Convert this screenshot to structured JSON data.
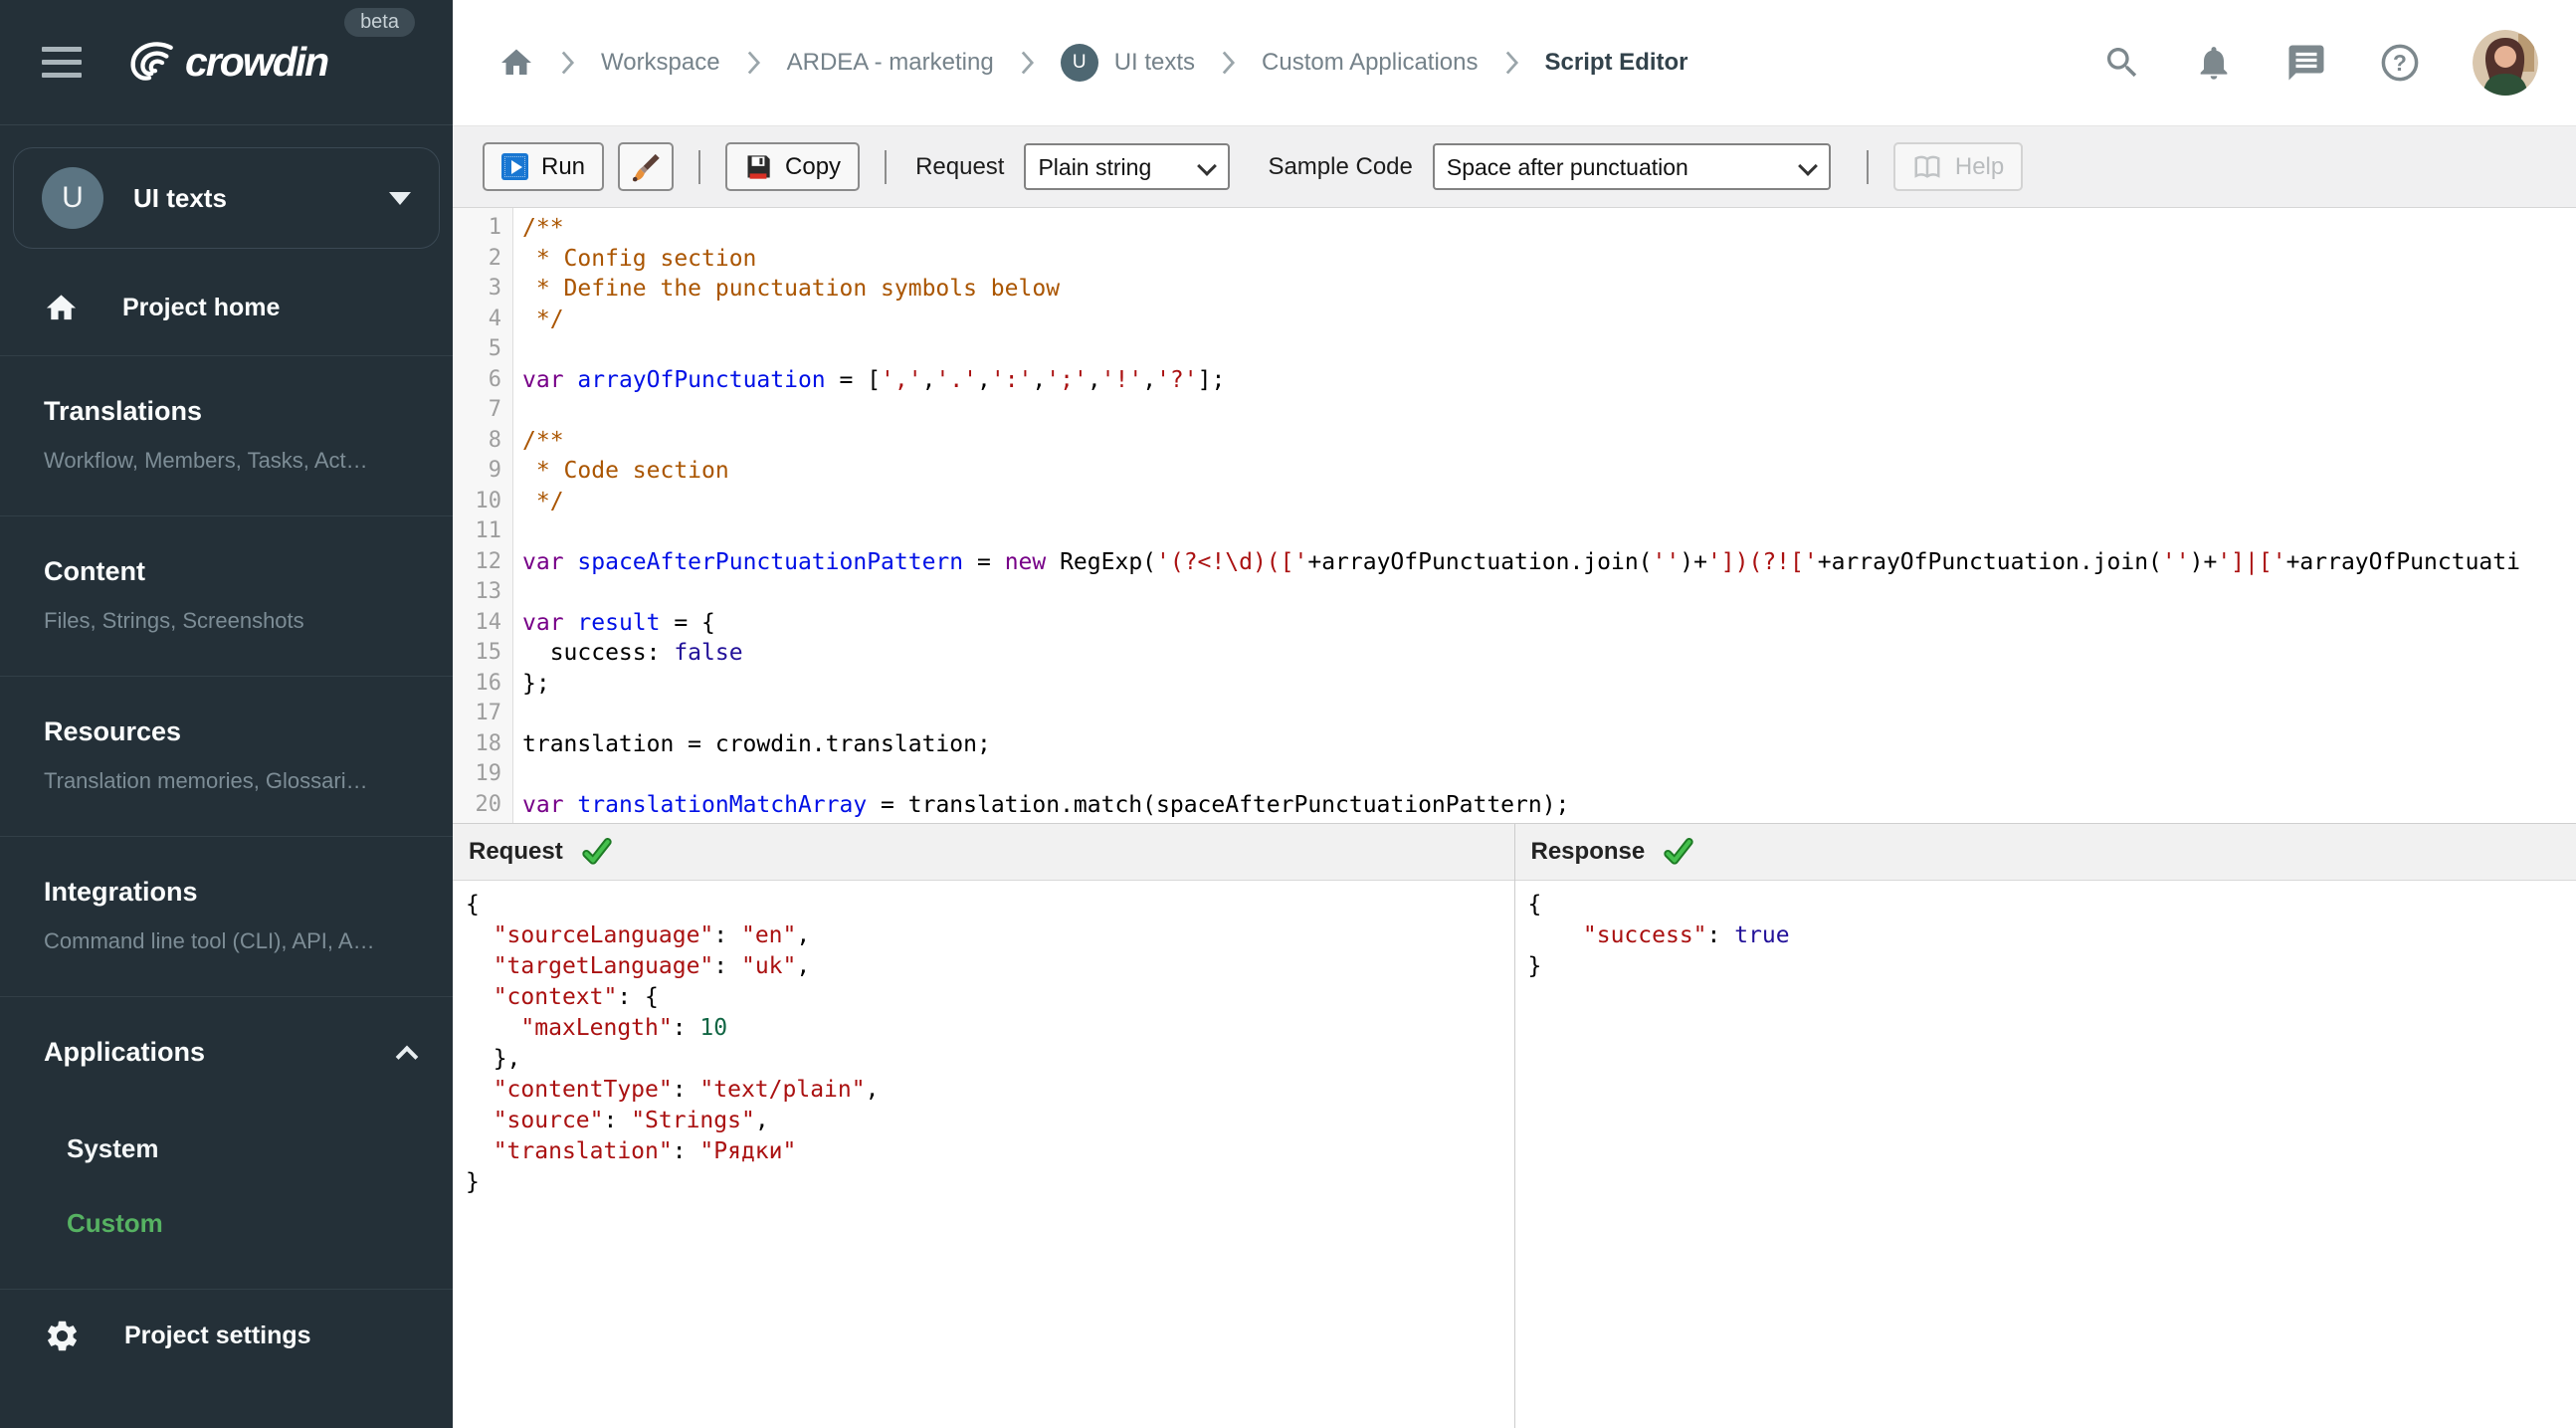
{
  "theme": {
    "sidebar_bg": "#243038",
    "accent_green": "#56b262",
    "run_icon_blue": "#1977d2",
    "check_green": "#2fa138",
    "syntax": {
      "comment": "#aa5500",
      "keyword": "#770088",
      "definition": "#0010e6",
      "string": "#aa1111",
      "number": "#116644",
      "atom": "#221199"
    }
  },
  "sidebar": {
    "logo_text": "crowdin",
    "beta_label": "beta",
    "project_selector": {
      "initial": "U",
      "name": "UI texts"
    },
    "project_home_label": "Project home",
    "sections": [
      {
        "title": "Translations",
        "subtitle": "Workflow, Members, Tasks, Act…"
      },
      {
        "title": "Content",
        "subtitle": "Files, Strings, Screenshots"
      },
      {
        "title": "Resources",
        "subtitle": "Translation memories, Glossari…"
      },
      {
        "title": "Integrations",
        "subtitle": "Command line tool (CLI), API, A…"
      }
    ],
    "applications": {
      "title": "Applications",
      "children": [
        {
          "label": "System",
          "active": false
        },
        {
          "label": "Custom",
          "active": true
        }
      ]
    },
    "project_settings_label": "Project settings"
  },
  "header": {
    "breadcrumbs": {
      "workspace": "Workspace",
      "organization": "ARDEA - marketing",
      "project": "UI texts",
      "project_initial": "U",
      "section": "Custom Applications",
      "current": "Script Editor"
    },
    "icons": [
      "search-icon",
      "bell-icon",
      "chat-icon",
      "help-icon",
      "user-avatar"
    ]
  },
  "toolbar": {
    "run_label": "Run",
    "copy_label": "Copy",
    "request_label": "Request",
    "request_value": "Plain string",
    "sample_code_label": "Sample Code",
    "sample_code_value": "Space after punctuation",
    "help_label": "Help",
    "icons": [
      "run-icon",
      "brush-icon",
      "save-icon",
      "book-icon"
    ]
  },
  "editor": {
    "language": "javascript",
    "lines": [
      [
        {
          "c": "c",
          "t": "/**"
        }
      ],
      [
        {
          "c": "c",
          "t": " * Config section"
        }
      ],
      [
        {
          "c": "c",
          "t": " * Define the punctuation symbols below"
        }
      ],
      [
        {
          "c": "c",
          "t": " */"
        }
      ],
      [],
      [
        {
          "c": "k",
          "t": "var"
        },
        {
          "c": "p",
          "t": " "
        },
        {
          "c": "d",
          "t": "arrayOfPunctuation"
        },
        {
          "c": "p",
          "t": " = ["
        },
        {
          "c": "s",
          "t": "','"
        },
        {
          "c": "p",
          "t": ","
        },
        {
          "c": "s",
          "t": "'.'"
        },
        {
          "c": "p",
          "t": ","
        },
        {
          "c": "s",
          "t": "':'"
        },
        {
          "c": "p",
          "t": ","
        },
        {
          "c": "s",
          "t": "';'"
        },
        {
          "c": "p",
          "t": ","
        },
        {
          "c": "s",
          "t": "'!'"
        },
        {
          "c": "p",
          "t": ","
        },
        {
          "c": "s",
          "t": "'?'"
        },
        {
          "c": "p",
          "t": "];"
        }
      ],
      [],
      [
        {
          "c": "c",
          "t": "/**"
        }
      ],
      [
        {
          "c": "c",
          "t": " * Code section"
        }
      ],
      [
        {
          "c": "c",
          "t": " */"
        }
      ],
      [],
      [
        {
          "c": "k",
          "t": "var"
        },
        {
          "c": "p",
          "t": " "
        },
        {
          "c": "d",
          "t": "spaceAfterPunctuationPattern"
        },
        {
          "c": "p",
          "t": " = "
        },
        {
          "c": "k",
          "t": "new"
        },
        {
          "c": "p",
          "t": " RegExp("
        },
        {
          "c": "s",
          "t": "'(?<!\\d)(['"
        },
        {
          "c": "p",
          "t": "+arrayOfPunctuation.join("
        },
        {
          "c": "s",
          "t": "''"
        },
        {
          "c": "p",
          "t": ")+"
        },
        {
          "c": "s",
          "t": "'])(?!['"
        },
        {
          "c": "p",
          "t": "+arrayOfPunctuation.join("
        },
        {
          "c": "s",
          "t": "''"
        },
        {
          "c": "p",
          "t": ")+"
        },
        {
          "c": "s",
          "t": "']|['"
        },
        {
          "c": "p",
          "t": "+arrayOfPunctuati"
        }
      ],
      [],
      [
        {
          "c": "k",
          "t": "var"
        },
        {
          "c": "p",
          "t": " "
        },
        {
          "c": "d",
          "t": "result"
        },
        {
          "c": "p",
          "t": " = {"
        }
      ],
      [
        {
          "c": "p",
          "t": "  success: "
        },
        {
          "c": "a",
          "t": "false"
        }
      ],
      [
        {
          "c": "p",
          "t": "};"
        }
      ],
      [],
      [
        {
          "c": "p",
          "t": "translation = crowdin.translation;"
        }
      ],
      [],
      [
        {
          "c": "k",
          "t": "var"
        },
        {
          "c": "p",
          "t": " "
        },
        {
          "c": "d",
          "t": "translationMatchArray"
        },
        {
          "c": "p",
          "t": " = translation.match(spaceAfterPunctuationPattern);"
        }
      ],
      []
    ]
  },
  "request_panel": {
    "title": "Request",
    "status_icon": "check-icon",
    "lines": [
      [
        {
          "c": "p",
          "t": "{"
        }
      ],
      [
        {
          "c": "p",
          "t": "  "
        },
        {
          "c": "s",
          "t": "\"sourceLanguage\""
        },
        {
          "c": "p",
          "t": ": "
        },
        {
          "c": "s",
          "t": "\"en\""
        },
        {
          "c": "p",
          "t": ","
        }
      ],
      [
        {
          "c": "p",
          "t": "  "
        },
        {
          "c": "s",
          "t": "\"targetLanguage\""
        },
        {
          "c": "p",
          "t": ": "
        },
        {
          "c": "s",
          "t": "\"uk\""
        },
        {
          "c": "p",
          "t": ","
        }
      ],
      [
        {
          "c": "p",
          "t": "  "
        },
        {
          "c": "s",
          "t": "\"context\""
        },
        {
          "c": "p",
          "t": ": {"
        }
      ],
      [
        {
          "c": "p",
          "t": "    "
        },
        {
          "c": "s",
          "t": "\"maxLength\""
        },
        {
          "c": "p",
          "t": ": "
        },
        {
          "c": "n",
          "t": "10"
        }
      ],
      [
        {
          "c": "p",
          "t": "  },"
        }
      ],
      [
        {
          "c": "p",
          "t": "  "
        },
        {
          "c": "s",
          "t": "\"contentType\""
        },
        {
          "c": "p",
          "t": ": "
        },
        {
          "c": "s",
          "t": "\"text/plain\""
        },
        {
          "c": "p",
          "t": ","
        }
      ],
      [
        {
          "c": "p",
          "t": "  "
        },
        {
          "c": "s",
          "t": "\"source\""
        },
        {
          "c": "p",
          "t": ": "
        },
        {
          "c": "s",
          "t": "\"Strings\""
        },
        {
          "c": "p",
          "t": ","
        }
      ],
      [
        {
          "c": "p",
          "t": "  "
        },
        {
          "c": "s",
          "t": "\"translation\""
        },
        {
          "c": "p",
          "t": ": "
        },
        {
          "c": "s",
          "t": "\"Рядки\""
        }
      ],
      [
        {
          "c": "p",
          "t": "}"
        }
      ]
    ]
  },
  "response_panel": {
    "title": "Response",
    "status_icon": "check-icon",
    "lines": [
      [
        {
          "c": "p",
          "t": "{"
        }
      ],
      [
        {
          "c": "p",
          "t": "    "
        },
        {
          "c": "s",
          "t": "\"success\""
        },
        {
          "c": "p",
          "t": ": "
        },
        {
          "c": "a",
          "t": "true"
        }
      ],
      [
        {
          "c": "p",
          "t": "}"
        }
      ]
    ]
  }
}
